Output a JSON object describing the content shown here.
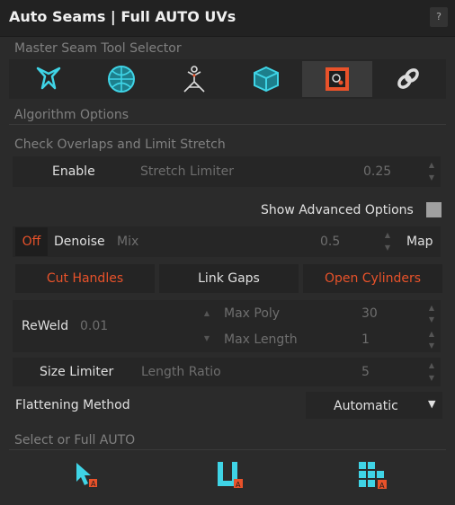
{
  "title": "Auto Seams | Full AUTO UVs",
  "help_label": "?",
  "master_section": "Master Seam Tool Selector",
  "tools": [
    "x-seam-icon",
    "sphere-seam-icon",
    "figure-seam-icon",
    "cube-seam-icon",
    "box-select-icon",
    "link-icon"
  ],
  "algorithm_section": "Algorithm Options",
  "overlap_section": "Check Overlaps and Limit Stretch",
  "overlap": {
    "enable": "Enable",
    "limiter_label": "Stretch Limiter",
    "limiter_value": "0.25"
  },
  "advanced": {
    "label": "Show Advanced Options"
  },
  "denoise": {
    "off": "Off",
    "label": "Denoise",
    "mix": "Mix",
    "value": "0.5",
    "map": "Map"
  },
  "buttons": {
    "cut_handles": "Cut Handles",
    "link_gaps": "Link Gaps",
    "open_cylinders": "Open Cylinders"
  },
  "reweld": {
    "label": "ReWeld",
    "value": "0.01",
    "max_poly_label": "Max Poly",
    "max_poly_value": "30",
    "max_length_label": "Max Length",
    "max_length_value": "1"
  },
  "size_limiter": {
    "label": "Size Limiter",
    "ratio_label": "Length Ratio",
    "ratio_value": "5"
  },
  "flattening": {
    "label": "Flattening Method",
    "value": "Automatic"
  },
  "select_section": "Select or Full AUTO",
  "colors": {
    "accent_orange": "#e8522a",
    "icon_cyan": "#3fd4e6"
  }
}
